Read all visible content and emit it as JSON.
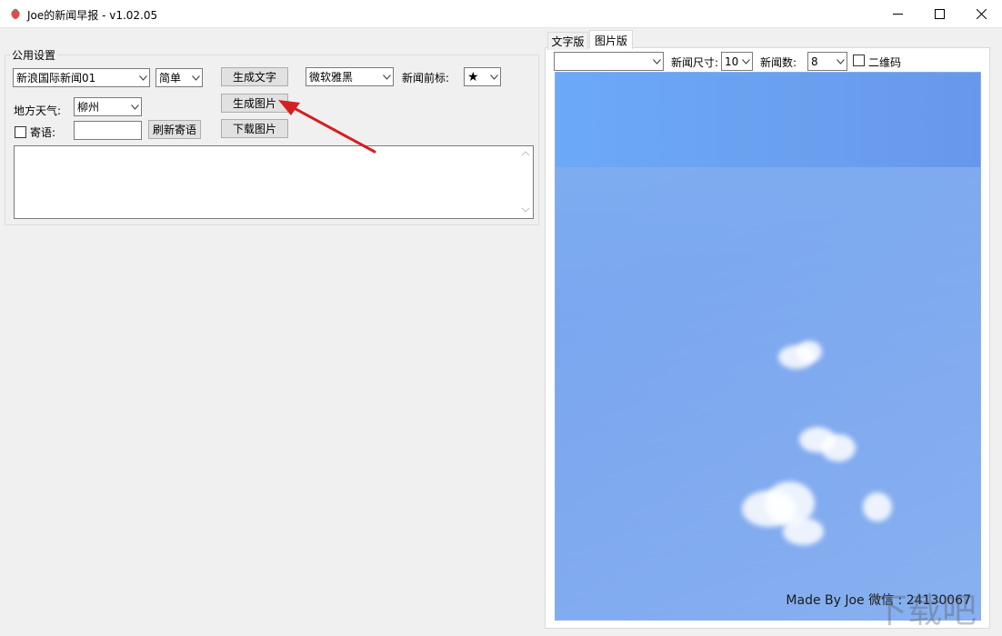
{
  "window": {
    "title": "Joe的新闻早报 - v1.02.05",
    "minimize_glyph": "—",
    "maximize_glyph": "☐",
    "close_glyph": "✕"
  },
  "settings": {
    "group_title": "公用设置",
    "news_source": "新浪国际新闻01",
    "style_mode": "简单",
    "weather_label": "地方天气:",
    "city": "柳州",
    "message_label": "寄语:",
    "message_value": "",
    "refresh_message_button": "刷新寄语",
    "generate_text_button": "生成文字",
    "generate_image_button": "生成图片",
    "download_image_button": "下载图片",
    "font": "微软雅黑",
    "prefix_label": "新闻前标:",
    "prefix_value": "★"
  },
  "output_text": "",
  "tabs": {
    "text_tab": "文字版",
    "image_tab": "图片版"
  },
  "image_tab": {
    "template_value": "",
    "size_label": "新闻尺寸:",
    "size_value": "10",
    "count_label": "新闻数:",
    "count_value": "8",
    "qr_label": "二维码",
    "credit": "Made By Joe 微信 : 24130067"
  },
  "watermark_text": "下载吧",
  "colors": {
    "arrow": "#d42020",
    "preview_sky": "#6fa3f0"
  }
}
